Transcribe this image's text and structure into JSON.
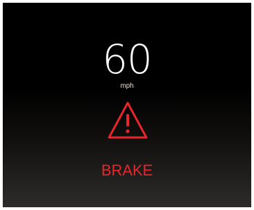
{
  "speed": {
    "value": "60",
    "unit": "mph"
  },
  "alert": {
    "icon": "warning-triangle-icon",
    "label": "BRAKE"
  },
  "colors": {
    "alert_red": "#e8262c",
    "speed_text": "#ffffff",
    "unit_text": "#e8e0d8"
  }
}
